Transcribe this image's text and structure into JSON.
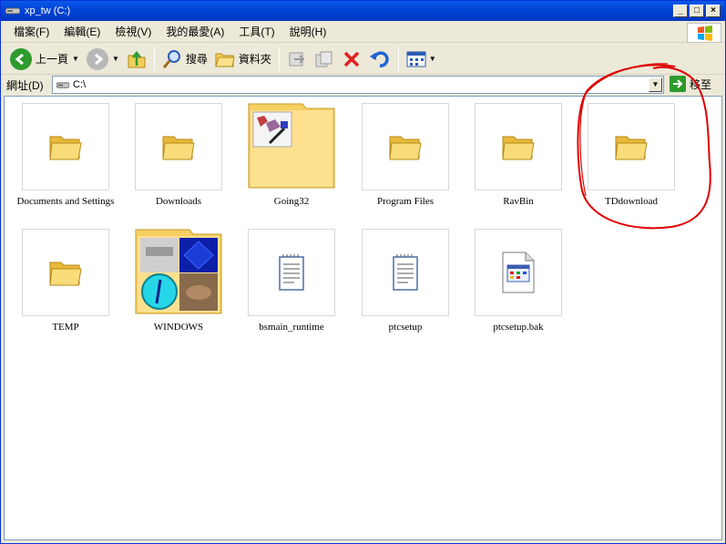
{
  "window": {
    "title": "xp_tw (C:)",
    "controls": {
      "minimize": "_",
      "maximize": "□",
      "close": "×"
    }
  },
  "menu": {
    "items": [
      "檔案(F)",
      "編輯(E)",
      "檢視(V)",
      "我的最愛(A)",
      "工具(T)",
      "說明(H)"
    ]
  },
  "toolbar": {
    "back_label": "上一頁",
    "search_label": "搜尋",
    "folders_label": "資料夾"
  },
  "address": {
    "label": "網址(D)",
    "value": "C:\\",
    "go_label": "移至"
  },
  "items": [
    {
      "label": "Documents and Settings",
      "type": "folder",
      "selected": true
    },
    {
      "label": "Downloads",
      "type": "folder"
    },
    {
      "label": "Going32",
      "type": "folder-preview"
    },
    {
      "label": "Program Files",
      "type": "folder"
    },
    {
      "label": "RavBin",
      "type": "folder"
    },
    {
      "label": "TDdownload",
      "type": "folder",
      "annotated": true
    },
    {
      "label": "TEMP",
      "type": "folder"
    },
    {
      "label": "WINDOWS",
      "type": "folder-preview"
    },
    {
      "label": "bsmain_runtime",
      "type": "text-file"
    },
    {
      "label": "ptcsetup",
      "type": "text-file"
    },
    {
      "label": "ptcsetup.bak",
      "type": "app-file"
    }
  ],
  "colors": {
    "titlebar": "#0045d8",
    "folder": "#f7d66b",
    "annotation": "#e00000"
  }
}
